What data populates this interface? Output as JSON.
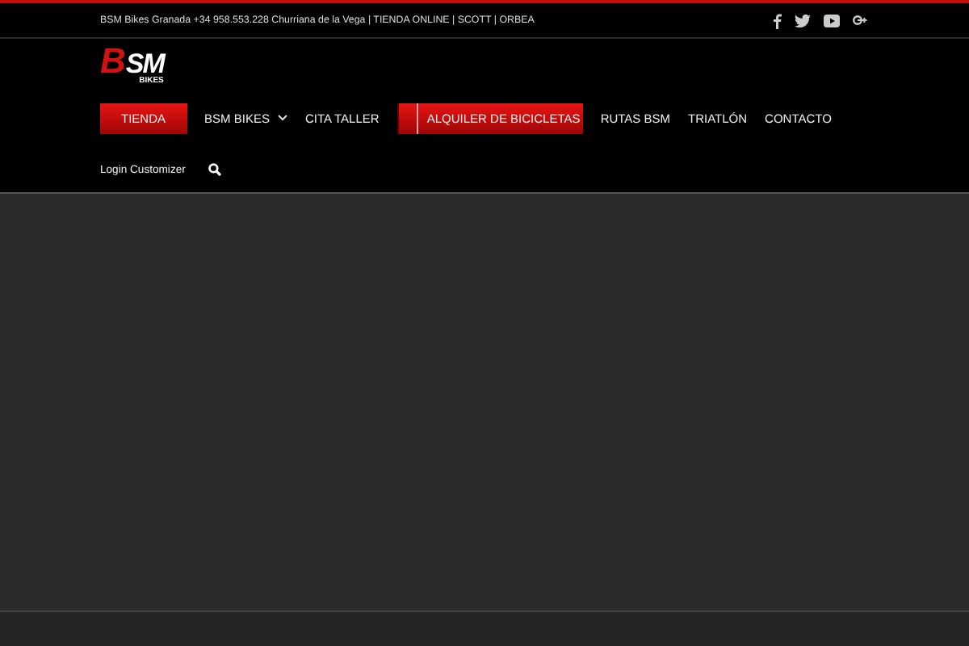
{
  "top_bar": {
    "contact": "BSM Bikes Granada +34 958.553.228 Churriana de la Vega | TIENDA ONLINE | SCOTT | ORBEA"
  },
  "logo": {
    "mark_red": "B",
    "mark_white": "SM",
    "subtitle": "BIKES"
  },
  "menu": [
    {
      "label": "TIENDA",
      "kind": "highlight",
      "dropdown": false,
      "divider": false
    },
    {
      "label": "BSM BIKES",
      "kind": "plain",
      "dropdown": true,
      "divider": false
    },
    {
      "label": "CITA TALLER",
      "kind": "plain",
      "dropdown": false,
      "divider": false
    },
    {
      "label": "ALQUILER DE BICICLETAS",
      "kind": "highlight",
      "dropdown": false,
      "divider": true
    },
    {
      "label": "RUTAS BSM",
      "kind": "plain",
      "dropdown": false,
      "divider": false
    },
    {
      "label": "TRIATLÓN",
      "kind": "plain",
      "dropdown": false,
      "divider": false
    },
    {
      "label": "CONTACTO",
      "kind": "plain",
      "dropdown": false,
      "divider": false
    },
    {
      "label": "Login Customizer",
      "kind": "small",
      "dropdown": false,
      "divider": false
    },
    {
      "kind": "search"
    }
  ]
}
